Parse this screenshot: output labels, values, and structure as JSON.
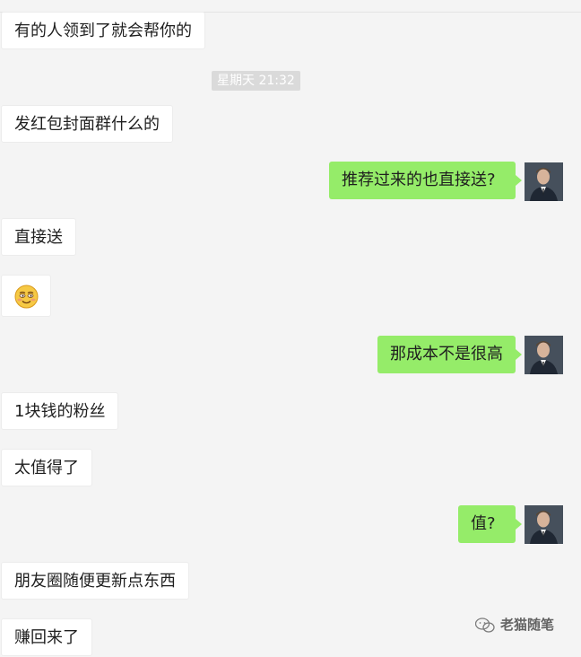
{
  "timestamp": "星期天 21:32",
  "messages": [
    {
      "side": "left",
      "text": "有的人领到了就会帮你的"
    },
    {
      "side": "left",
      "text": "发红包封面群什么的"
    },
    {
      "side": "right",
      "text": "推荐过来的也直接送?"
    },
    {
      "side": "left",
      "text": "直接送"
    },
    {
      "side": "left",
      "emoji": "smiling-face-emoji"
    },
    {
      "side": "right",
      "text": "那成本不是很高"
    },
    {
      "side": "left",
      "text": "1块钱的粉丝"
    },
    {
      "side": "left",
      "text": "太值得了"
    },
    {
      "side": "right",
      "text": "值?"
    },
    {
      "side": "left",
      "text": "朋友圈随便更新点东西"
    },
    {
      "side": "left",
      "text": "赚回来了"
    }
  ],
  "watermark": {
    "text": "老猫随笔",
    "icon": "wechat-logo-icon"
  },
  "colors": {
    "outgoing_bubble": "#95ec69",
    "incoming_bubble": "#ffffff",
    "background": "#f4f4f4",
    "timestamp_bg": "#dadada"
  }
}
